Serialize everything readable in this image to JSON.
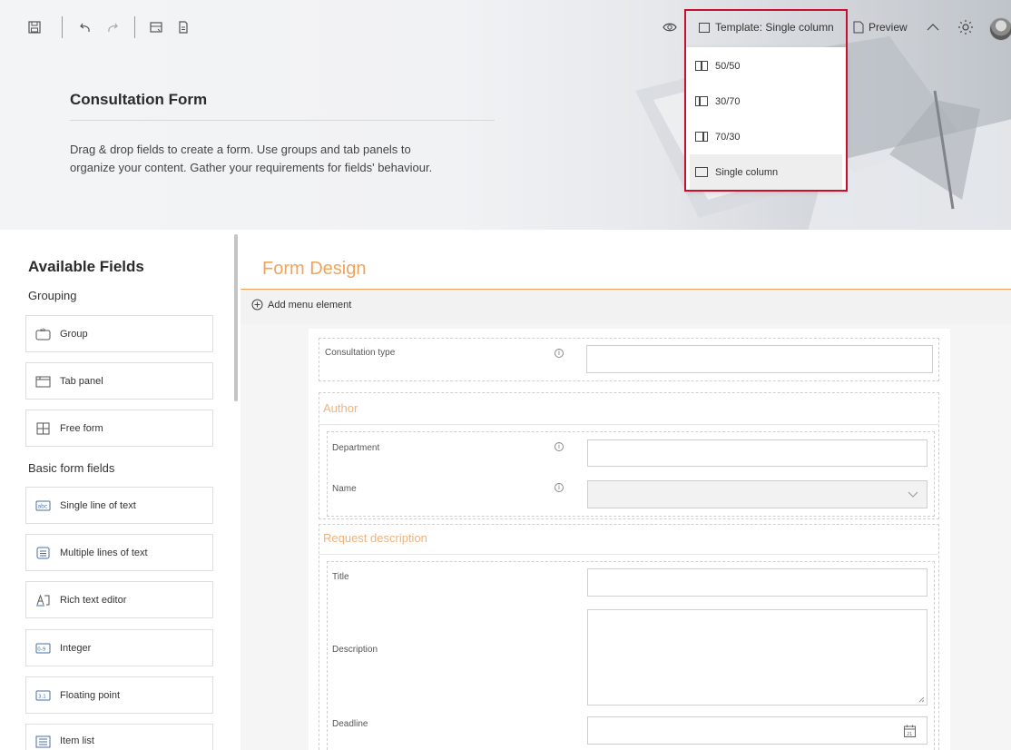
{
  "toolbar": {
    "icons": [
      "save-icon",
      "undo-icon",
      "redo-icon",
      "form-settings-icon",
      "document-icon"
    ],
    "template_label": "Template: Single column",
    "preview_label": "Preview"
  },
  "template_menu": {
    "items": [
      {
        "label": "50/50",
        "icon": "layout-50-50-icon",
        "active": false
      },
      {
        "label": "30/70",
        "icon": "layout-30-70-icon",
        "active": false
      },
      {
        "label": "70/30",
        "icon": "layout-70-30-icon",
        "active": false
      },
      {
        "label": "Single column",
        "icon": "layout-single-column-icon",
        "active": true
      }
    ]
  },
  "header": {
    "title": "Consultation Form",
    "description_line1": "Drag & drop fields to create a form. Use groups and tab panels to",
    "description_line2": "organize your content. Gather your requirements for fields' behaviour."
  },
  "available_fields": {
    "title": "Available Fields",
    "grouping_label": "Grouping",
    "grouping": [
      {
        "label": "Group",
        "icon": "group-icon"
      },
      {
        "label": "Tab panel",
        "icon": "tab-panel-icon"
      },
      {
        "label": "Free form",
        "icon": "free-form-icon"
      }
    ],
    "basic_label": "Basic form fields",
    "basic": [
      {
        "label": "Single line of text",
        "icon": "single-line-text-icon",
        "badge": "abc"
      },
      {
        "label": "Multiple lines of text",
        "icon": "multi-line-text-icon"
      },
      {
        "label": "Rich text editor",
        "icon": "rich-text-icon"
      },
      {
        "label": "Integer",
        "icon": "integer-icon",
        "badge": "0-9"
      },
      {
        "label": "Floating point",
        "icon": "floating-point-icon",
        "badge": "3.1"
      },
      {
        "label": "Item list",
        "icon": "item-list-icon"
      }
    ]
  },
  "form_design": {
    "title": "Form Design",
    "add_menu_label": "Add menu element",
    "consultation_type_label": "Consultation type",
    "author_section": "Author",
    "department_label": "Department",
    "name_label": "Name",
    "request_section": "Request description",
    "title_label": "Title",
    "description_label": "Description",
    "deadline_label": "Deadline",
    "calendar_day": "21"
  },
  "colors": {
    "accent": "#f0a45a",
    "highlight_border": "#c8102e"
  }
}
